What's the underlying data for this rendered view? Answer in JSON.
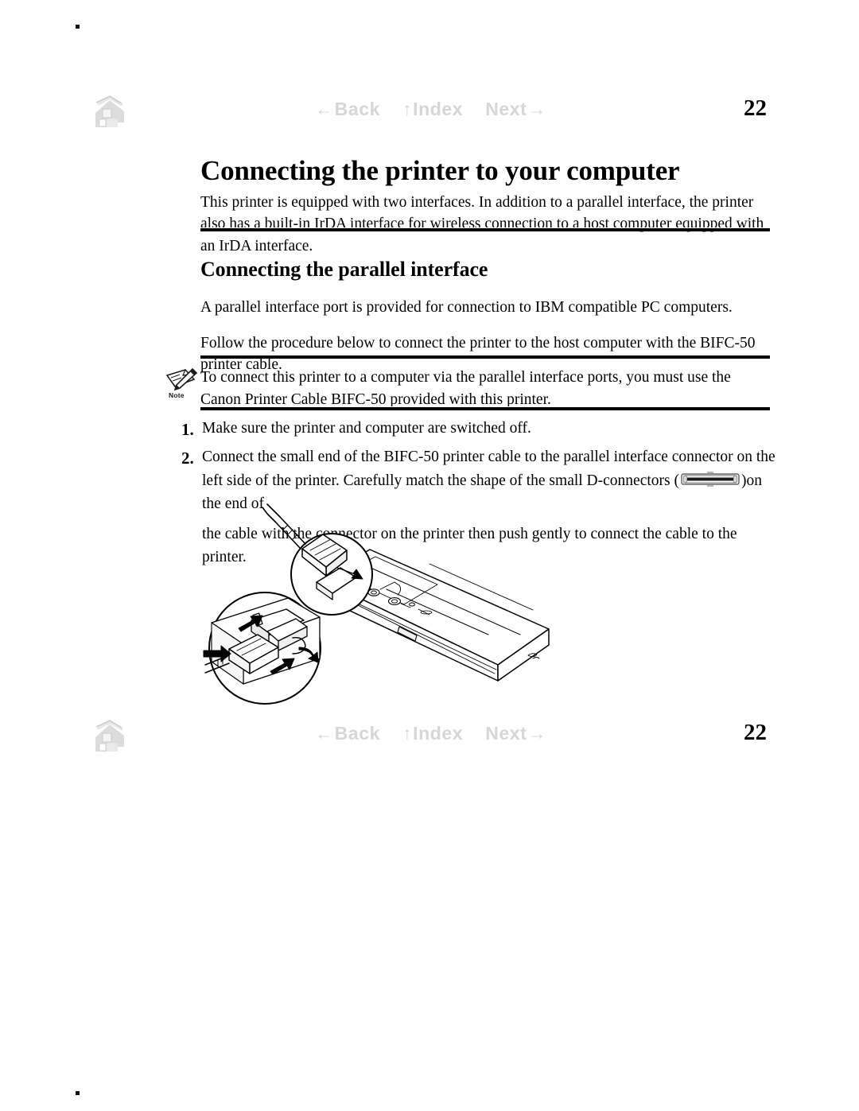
{
  "document": {
    "page_number": "22",
    "registration_marks": 2
  },
  "nav": {
    "home_icon": "home-icon",
    "links": [
      {
        "icon": "arrow-left-icon",
        "arrow": "←",
        "arrow_side": "before",
        "label": "Back"
      },
      {
        "icon": "arrow-up-icon",
        "arrow": "↑",
        "arrow_side": "before",
        "label": "Index"
      },
      {
        "icon": "arrow-right-icon",
        "arrow": "→",
        "arrow_side": "after",
        "label": "Next"
      }
    ],
    "color": "#d6d6d6"
  },
  "content": {
    "title": "Connecting the printer to your computer",
    "intro": "This printer is equipped with two interfaces. In addition to a parallel interface, the printer also has a built-in IrDA interface for wireless connection to a host computer equipped with an IrDA interface.",
    "subheading": "Connecting the parallel interface",
    "paragraph_1": "A parallel interface port is provided for connection to IBM compatible PC computers.",
    "paragraph_2": "Follow the procedure below to connect the printer to the host computer with the BIFC-50 printer cable.",
    "note": {
      "icon": "note-pencil-icon",
      "icon_label": "Note",
      "text": "To connect this printer to a computer via the parallel interface ports, you must use the Canon Printer Cable BIFC-50 provided with this printer."
    },
    "steps": [
      {
        "number": "1.",
        "text": "Make sure the printer and computer are switched off."
      },
      {
        "number": "2.",
        "text_before_icon": "Connect the small end of the BIFC-50 printer cable to the parallel interface connector on the left side of the printer. Carefully match the shape of the small D-connectors",
        "inline_icon": "d-connector-icon",
        "text_after_icon": "on the end of",
        "text_line_3": "the cable with the connector on the printer then push gently to connect the cable to the printer."
      }
    ],
    "illustration": {
      "name": "printer-cable-connection-diagram",
      "caption": "",
      "elements": [
        "portable-inkjet-printer",
        "callout-circle-top",
        "callout-circle-bottom",
        "parallel-cable-connector",
        "direction-arrows"
      ]
    }
  },
  "colors": {
    "text": "#000000",
    "nav_disabled": "#d6d6d6",
    "rule": "#000000",
    "background": "#ffffff"
  }
}
